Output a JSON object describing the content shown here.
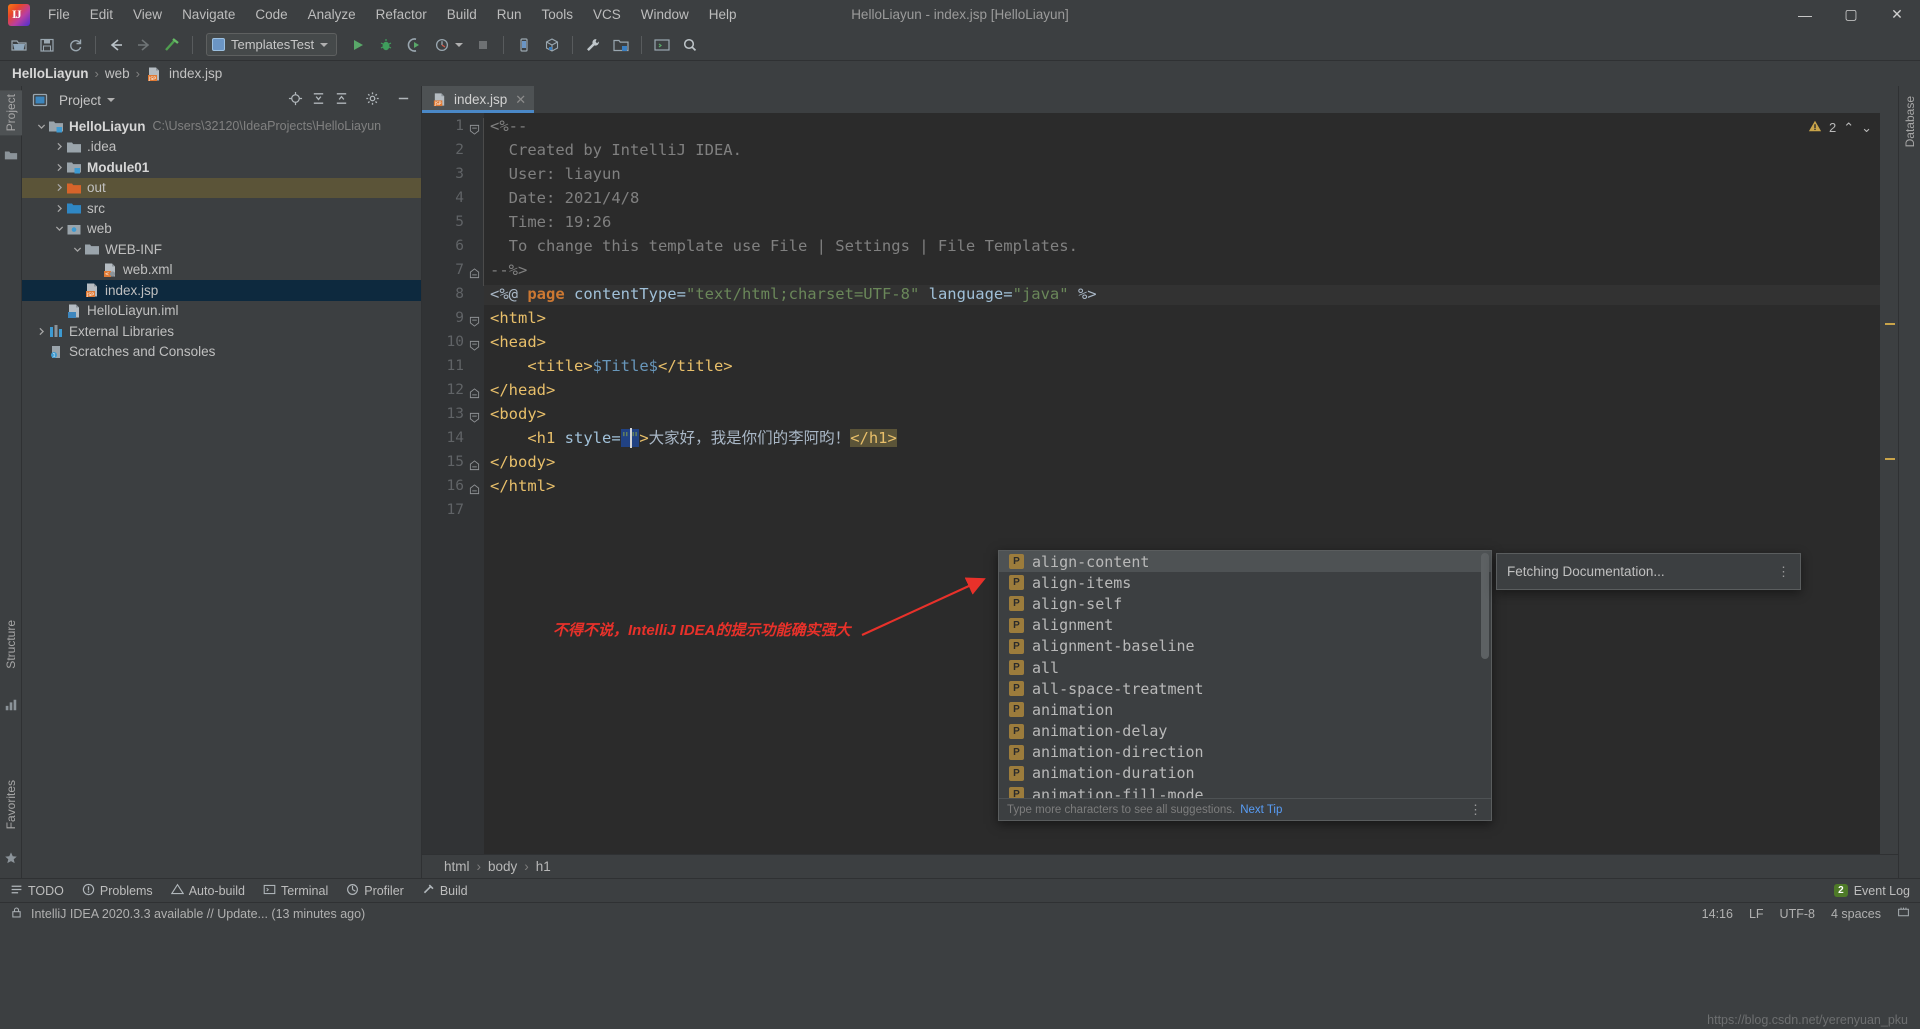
{
  "window": {
    "title": "HelloLiayun - index.jsp [HelloLiayun]",
    "minimize": "—",
    "maximize": "▢",
    "close": "✕"
  },
  "menubar": {
    "items": [
      {
        "label": "File"
      },
      {
        "label": "Edit"
      },
      {
        "label": "View"
      },
      {
        "label": "Navigate"
      },
      {
        "label": "Code"
      },
      {
        "label": "Analyze"
      },
      {
        "label": "Refactor"
      },
      {
        "label": "Build"
      },
      {
        "label": "Run"
      },
      {
        "label": "Tools"
      },
      {
        "label": "VCS"
      },
      {
        "label": "Window"
      },
      {
        "label": "Help"
      }
    ]
  },
  "toolbar": {
    "run_config": "TemplatesTest",
    "icons": [
      "open-folder-icon",
      "save-all-icon",
      "sync-icon",
      "back-icon",
      "forward-icon",
      "build-hammer-icon",
      "run-icon",
      "debug-icon",
      "run-coverage-icon",
      "profile-icon",
      "stop-icon",
      "device-manager-icon",
      "avd-icon",
      "settings-wrench-icon",
      "project-structure-icon",
      "terminal-icon",
      "search-everywhere-icon"
    ]
  },
  "navbar": {
    "crumbs": [
      {
        "label": "HelloLiayun",
        "bold": true
      },
      {
        "label": "web",
        "bold": false
      },
      {
        "label": "index.jsp",
        "bold": false,
        "icon": "jsp-file-icon"
      }
    ],
    "separator": "›"
  },
  "left_strip": {
    "tabs": [
      "Project",
      "Structure",
      "Favorites"
    ]
  },
  "right_strip": {
    "tabs": [
      "Database"
    ]
  },
  "project_panel": {
    "title": "Project",
    "header_icons": [
      "locate-file-icon",
      "expand-all-icon",
      "collapse-all-icon",
      "settings-gear-icon",
      "hide-icon"
    ],
    "tree": [
      {
        "label": "HelloLiayun",
        "path": "C:\\Users\\32120\\IdeaProjects\\HelloLiayun",
        "indent": 0,
        "arrow": "open",
        "icon": "module-folder-icon",
        "bold": true,
        "state": "none"
      },
      {
        "label": ".idea",
        "path": "",
        "indent": 1,
        "arrow": "closed",
        "icon": "folder-icon",
        "bold": false,
        "state": "none"
      },
      {
        "label": "Module01",
        "path": "",
        "indent": 1,
        "arrow": "closed",
        "icon": "module-folder-icon",
        "bold": true,
        "state": "none"
      },
      {
        "label": "out",
        "path": "",
        "indent": 1,
        "arrow": "closed",
        "icon": "output-folder-icon",
        "bold": false,
        "state": "highlight"
      },
      {
        "label": "src",
        "path": "",
        "indent": 1,
        "arrow": "closed",
        "icon": "source-folder-icon",
        "bold": false,
        "state": "none"
      },
      {
        "label": "web",
        "path": "",
        "indent": 1,
        "arrow": "open",
        "icon": "web-root-folder-icon",
        "bold": false,
        "state": "none"
      },
      {
        "label": "WEB-INF",
        "path": "",
        "indent": 2,
        "arrow": "open",
        "icon": "folder-icon",
        "bold": false,
        "state": "none"
      },
      {
        "label": "web.xml",
        "path": "",
        "indent": 3,
        "arrow": "none",
        "icon": "xml-file-icon",
        "bold": false,
        "state": "none"
      },
      {
        "label": "index.jsp",
        "path": "",
        "indent": 2,
        "arrow": "none",
        "icon": "jsp-file-icon",
        "bold": false,
        "state": "selected"
      },
      {
        "label": "HelloLiayun.iml",
        "path": "",
        "indent": 1,
        "arrow": "none",
        "icon": "iml-file-icon",
        "bold": false,
        "state": "none"
      },
      {
        "label": "External Libraries",
        "path": "",
        "indent": 0,
        "arrow": "closed",
        "icon": "libraries-icon",
        "bold": false,
        "state": "none"
      },
      {
        "label": "Scratches and Consoles",
        "path": "",
        "indent": 0,
        "arrow": "none",
        "icon": "scratches-icon",
        "bold": false,
        "state": "none"
      }
    ]
  },
  "editor": {
    "tab": {
      "label": "index.jsp",
      "icon": "jsp-file-icon",
      "close": "✕"
    },
    "inspection": {
      "warning_count": "2",
      "warn_icon": "warning-triangle-icon",
      "up": "⌃",
      "down": "⌄"
    },
    "line_numbers": [
      "1",
      "2",
      "3",
      "4",
      "5",
      "6",
      "7",
      "8",
      "9",
      "10",
      "11",
      "12",
      "13",
      "14",
      "15",
      "16",
      "17"
    ],
    "code_lines": [
      {
        "n": 1,
        "segments": [
          {
            "t": "<%--",
            "c": "t-cmt"
          }
        ]
      },
      {
        "n": 2,
        "segments": [
          {
            "t": "  Created by IntelliJ IDEA.",
            "c": "t-cmt"
          }
        ]
      },
      {
        "n": 3,
        "segments": [
          {
            "t": "  User: liayun",
            "c": "t-cmt"
          }
        ]
      },
      {
        "n": 4,
        "segments": [
          {
            "t": "  Date: 2021/4/8",
            "c": "t-cmt"
          }
        ]
      },
      {
        "n": 5,
        "segments": [
          {
            "t": "  Time: 19:26",
            "c": "t-cmt"
          }
        ]
      },
      {
        "n": 6,
        "segments": [
          {
            "t": "  To change this template use File | Settings | File Templates.",
            "c": "t-cmt"
          }
        ]
      },
      {
        "n": 7,
        "segments": [
          {
            "t": "--%>",
            "c": "t-cmt"
          }
        ]
      },
      {
        "n": 8,
        "segments": [
          {
            "t": "<%@ ",
            "c": "t-plain"
          },
          {
            "t": "page",
            "c": "t-kw"
          },
          {
            "t": " contentType=",
            "c": "t-attr"
          },
          {
            "t": "\"text/html;charset=UTF-8\"",
            "c": "t-str"
          },
          {
            "t": " language=",
            "c": "t-attr"
          },
          {
            "t": "\"java\"",
            "c": "t-str"
          },
          {
            "t": " %>",
            "c": "t-plain"
          }
        ]
      },
      {
        "n": 9,
        "segments": [
          {
            "t": "<html>",
            "c": "t-tag"
          }
        ]
      },
      {
        "n": 10,
        "segments": [
          {
            "t": "<head>",
            "c": "t-tag"
          }
        ]
      },
      {
        "n": 11,
        "segments": [
          {
            "t": "    <title>",
            "c": "t-tag"
          },
          {
            "t": "$Title$",
            "c": "t-el"
          },
          {
            "t": "</title>",
            "c": "t-tag"
          }
        ]
      },
      {
        "n": 12,
        "segments": [
          {
            "t": "</head>",
            "c": "t-tag"
          }
        ]
      },
      {
        "n": 13,
        "segments": [
          {
            "t": "<body>",
            "c": "t-tag"
          }
        ]
      },
      {
        "n": 14,
        "segments": [
          {
            "t": "    <h1 ",
            "c": "t-tag"
          },
          {
            "t": "style=",
            "c": "t-attr"
          },
          {
            "t": "\"\"",
            "c": "t-str"
          },
          {
            "t": ">",
            "c": "t-tag"
          },
          {
            "t": "大家好，我是你们的李阿昀！",
            "c": "t-txt"
          },
          {
            "t": "</h1>",
            "c": "t-tag"
          }
        ]
      },
      {
        "n": 15,
        "segments": [
          {
            "t": "</body>",
            "c": "t-tag"
          }
        ]
      },
      {
        "n": 16,
        "segments": [
          {
            "t": "</html>",
            "c": "t-tag"
          }
        ]
      },
      {
        "n": 17,
        "segments": [
          {
            "t": "",
            "c": "t-plain"
          }
        ]
      }
    ],
    "breadcrumbs": [
      "html",
      "body",
      "h1"
    ],
    "breadcrumb_separator": "›"
  },
  "autocomplete": {
    "items": [
      {
        "label": "align-content",
        "badge": "P",
        "selected": true
      },
      {
        "label": "align-items",
        "badge": "P",
        "selected": false
      },
      {
        "label": "align-self",
        "badge": "P",
        "selected": false
      },
      {
        "label": "alignment",
        "badge": "P",
        "selected": false
      },
      {
        "label": "alignment-baseline",
        "badge": "P",
        "selected": false
      },
      {
        "label": "all",
        "badge": "P",
        "selected": false
      },
      {
        "label": "all-space-treatment",
        "badge": "P",
        "selected": false
      },
      {
        "label": "animation",
        "badge": "P",
        "selected": false
      },
      {
        "label": "animation-delay",
        "badge": "P",
        "selected": false
      },
      {
        "label": "animation-direction",
        "badge": "P",
        "selected": false
      },
      {
        "label": "animation-duration",
        "badge": "P",
        "selected": false
      },
      {
        "label": "animation-fill-mode",
        "badge": "P",
        "selected": false
      }
    ],
    "footer_hint": "Type more characters to see all suggestions.",
    "footer_link": "Next Tip",
    "footer_menu_icon": "more-options-icon"
  },
  "documentation_popup": {
    "text": "Fetching Documentation...",
    "menu_icon": "more-options-icon"
  },
  "annotation": {
    "text": "不得不说，IntelliJ IDEA的提示功能确实强大",
    "color": "#e8312a",
    "arrow_icon": "red-arrow-icon"
  },
  "toolwindow_bar": {
    "items": [
      {
        "label": "TODO",
        "icon": "todo-icon"
      },
      {
        "label": "Problems",
        "icon": "problems-icon"
      },
      {
        "label": "Auto-build",
        "icon": "autobuild-icon"
      },
      {
        "label": "Terminal",
        "icon": "terminal-icon"
      },
      {
        "label": "Profiler",
        "icon": "profiler-icon"
      },
      {
        "label": "Build",
        "icon": "build-icon"
      }
    ],
    "event_log": {
      "label": "Event Log",
      "count": "2"
    }
  },
  "status_bar": {
    "message": "IntelliJ IDEA 2020.3.3 available // Update... (13 minutes ago)",
    "caret_position": "14:16",
    "line_separator": "LF",
    "encoding": "UTF-8",
    "indent": "4 spaces",
    "lock_icon": "lock-icon",
    "memory_icon": "memory-icon"
  },
  "watermark": "https://blog.csdn.net/yerenyuan_pku",
  "colors": {
    "accent": "#4a88c7",
    "selection": "#0d293e",
    "highlight_out": "#5b5438",
    "annotation_red": "#e8312a",
    "bg_panel": "#3c3f41",
    "bg_editor": "#2b2b2b"
  }
}
